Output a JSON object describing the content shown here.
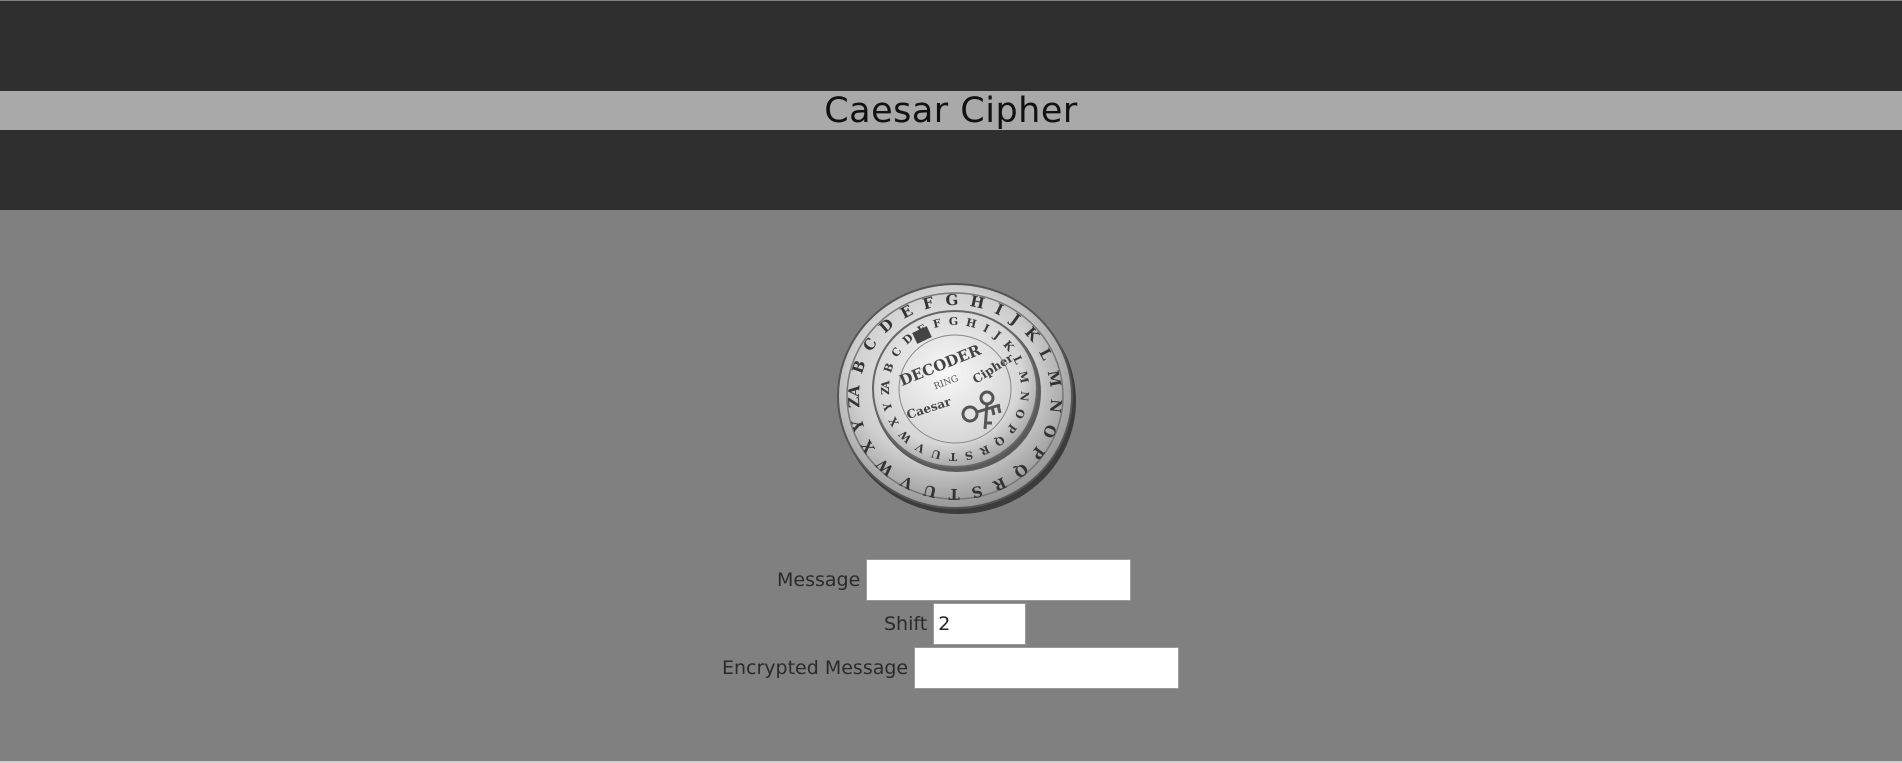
{
  "header": {
    "title": "Caesar Cipher"
  },
  "coin": {
    "outer_letters": "ABCDEFGHIJKLMNOPQRSTUVWXYZ",
    "inner_letters": "ABCDEFGHIJKLMNOPQRSTUVWXYZ",
    "line1": "DECODER",
    "line2": "RING",
    "line3": "Caesar",
    "line4": "Cipher"
  },
  "form": {
    "message_label": "Message",
    "message_value": "",
    "shift_label": "Shift",
    "shift_value": "2",
    "encrypted_label": "Encrypted Message",
    "encrypted_value": ""
  },
  "colors": {
    "header_bg": "#2f2f2f",
    "title_strip_bg": "#a9a9a9",
    "page_bg": "#808080"
  }
}
